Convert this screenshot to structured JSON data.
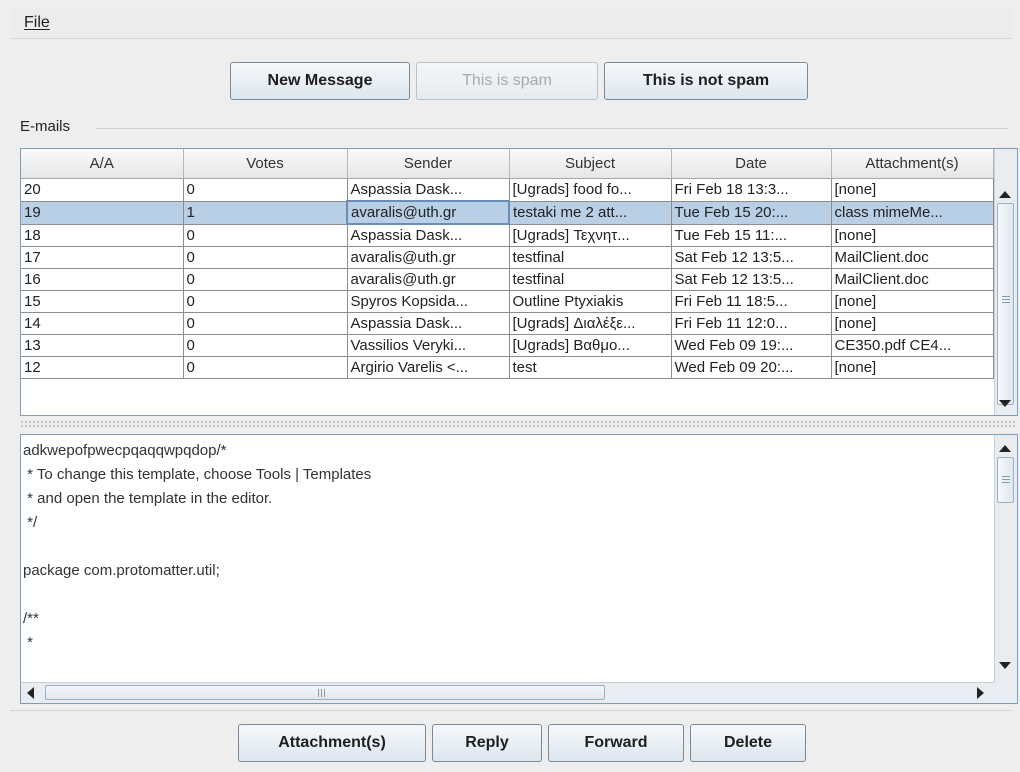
{
  "menu": {
    "file_label": "File"
  },
  "toolbar": {
    "new_message_label": "New Message",
    "spam_label": "This is spam",
    "not_spam_label": "This is not spam"
  },
  "emails": {
    "group_label": "E-mails",
    "columns": [
      "A/A",
      "Votes",
      "Sender",
      "Subject",
      "Date",
      "Attachment(s)"
    ],
    "selected_row": 1,
    "rows": [
      [
        "20",
        "0",
        "Aspassia Dask...",
        "[Ugrads] food fo...",
        "Fri Feb 18 13:3...",
        "[none]"
      ],
      [
        "19",
        "1",
        "avaralis@uth.gr",
        "testaki me 2 att...",
        "Tue Feb 15 20:...",
        "class mimeMe..."
      ],
      [
        "18",
        "0",
        "Aspassia Dask...",
        "[Ugrads] Τεχνητ...",
        "Tue Feb 15 11:...",
        "[none]"
      ],
      [
        "17",
        "0",
        "avaralis@uth.gr",
        "testfinal",
        "Sat Feb 12 13:5...",
        "MailClient.doc"
      ],
      [
        "16",
        "0",
        "avaralis@uth.gr",
        "testfinal",
        "Sat Feb 12 13:5...",
        "MailClient.doc"
      ],
      [
        "15",
        "0",
        "Spyros Kopsida...",
        "Outline Ptyxiakis",
        "Fri Feb 11 18:5...",
        "[none]"
      ],
      [
        "14",
        "0",
        "Aspassia Dask...",
        "[Ugrads] Διαλέξε...",
        "Fri Feb 11 12:0...",
        "[none]"
      ],
      [
        "13",
        "0",
        "Vassilios Veryki...",
        "[Ugrads] Βαθμο...",
        "Wed Feb 09 19:...",
        "CE350.pdf CE4..."
      ],
      [
        "12",
        "0",
        "Argirio Varelis <...",
        "test",
        "Wed Feb 09 20:...",
        "[none]"
      ]
    ]
  },
  "message_body": {
    "lines": [
      "adkwepofpwecpqaqqwpqdop/*",
      " * To change this template, choose Tools | Templates",
      " * and open the template in the editor.",
      " */",
      "",
      "package com.protomatter.util;",
      "",
      "/**",
      " *"
    ]
  },
  "actions": {
    "attachments_label": "Attachment(s)",
    "reply_label": "Reply",
    "forward_label": "Forward",
    "delete_label": "Delete"
  }
}
